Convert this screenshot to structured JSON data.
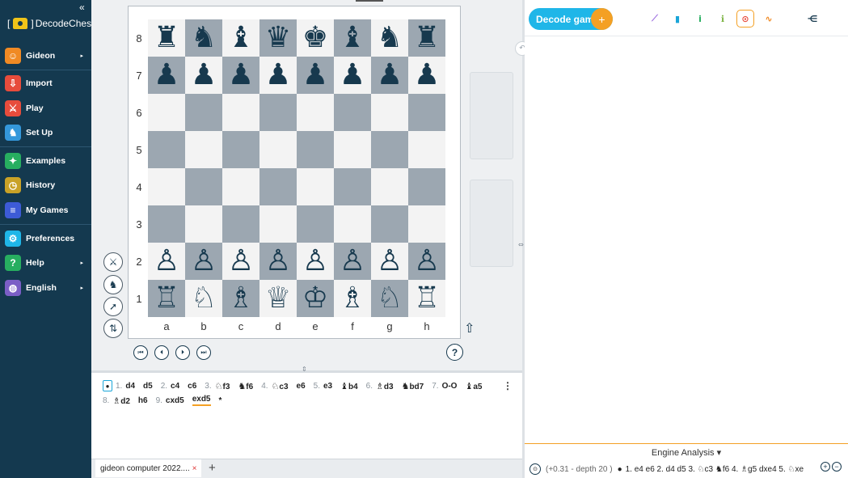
{
  "sidebar": {
    "collapse_icon": "«",
    "brand": "DecodeChess",
    "items": [
      {
        "label": "Gideon",
        "icon": "user-icon",
        "glyph": "☺",
        "color": "#f08a24",
        "arrow": "▸"
      },
      {
        "label": "Import",
        "icon": "import-icon",
        "glyph": "⇩",
        "color": "#e74c3c",
        "arrow": ""
      },
      {
        "label": "Play",
        "icon": "swords-icon",
        "glyph": "⚔",
        "color": "#e74c3c",
        "arrow": ""
      },
      {
        "label": "Set Up",
        "icon": "setup-icon",
        "glyph": "♞",
        "color": "#3498db",
        "arrow": ""
      },
      {
        "label": "Examples",
        "icon": "examples-icon",
        "glyph": "✦",
        "color": "#27ae60",
        "arrow": ""
      },
      {
        "label": "History",
        "icon": "clock-icon",
        "glyph": "◷",
        "color": "#c9a227",
        "arrow": ""
      },
      {
        "label": "My Games",
        "icon": "list-icon",
        "glyph": "≡",
        "color": "#3d5bd6",
        "arrow": ""
      },
      {
        "label": "Preferences",
        "icon": "gear-icon",
        "glyph": "⚙",
        "color": "#1fb6e8",
        "arrow": ""
      },
      {
        "label": "Help",
        "icon": "help-icon",
        "glyph": "?",
        "color": "#27ae60",
        "arrow": "▸"
      },
      {
        "label": "English",
        "icon": "globe-icon",
        "glyph": "◍",
        "color": "#7b5ec6",
        "arrow": "▸"
      }
    ]
  },
  "board": {
    "ranks": [
      "8",
      "7",
      "6",
      "5",
      "4",
      "3",
      "2",
      "1"
    ],
    "files": [
      "a",
      "b",
      "c",
      "d",
      "e",
      "f",
      "g",
      "h"
    ],
    "position": [
      [
        "♜",
        "♞",
        "♝",
        "♛",
        "♚",
        "♝",
        "♞",
        "♜"
      ],
      [
        "♟",
        "♟",
        "♟",
        "♟",
        "♟",
        "♟",
        "♟",
        "♟"
      ],
      [
        "",
        "",
        "",
        "",
        "",
        "",
        "",
        ""
      ],
      [
        "",
        "",
        "",
        "",
        "",
        "",
        "",
        ""
      ],
      [
        "",
        "",
        "",
        "",
        "",
        "",
        "",
        ""
      ],
      [
        "",
        "",
        "",
        "",
        "",
        "",
        "",
        ""
      ],
      [
        "♙",
        "♙",
        "♙",
        "♙",
        "♙",
        "♙",
        "♙",
        "♙"
      ],
      [
        "♖",
        "♘",
        "♗",
        "♕",
        "♔",
        "♗",
        "♘",
        "♖"
      ]
    ]
  },
  "tools": {
    "play_icon": "⚔",
    "setup_icon": "♞",
    "arrow_icon": "➚",
    "flip_icon": "⇅",
    "flip_up_icon": "⇧",
    "undo_icon": "↶",
    "help_label": "?"
  },
  "navigation": {
    "first": "⏮",
    "prev": "⏴",
    "next": "⏵",
    "last": "⏭"
  },
  "moves": {
    "start_marker": "●",
    "menu_icon": "⋮",
    "line1": [
      {
        "num": "1.",
        "white": "d4",
        "black": "d5"
      },
      {
        "num": "2.",
        "white": "c4",
        "black": "c6"
      },
      {
        "num": "3.",
        "white_piece": "♘",
        "white": "f3",
        "black_piece": "♞",
        "black": "f6"
      },
      {
        "num": "4.",
        "white_piece": "♘",
        "white": "c3",
        "black": "e6"
      },
      {
        "num": "5.",
        "white": "e3",
        "black_piece": "♝",
        "black": "b4"
      },
      {
        "num": "6.",
        "white_piece": "♗",
        "white": "d3",
        "black_piece": "♞",
        "black": "bd7"
      },
      {
        "num": "7.",
        "white": "O-O",
        "black_piece": "♝",
        "black": "a5"
      }
    ],
    "line2": [
      {
        "num": "8.",
        "white_piece": "♗",
        "white": "d2",
        "black": "h6"
      },
      {
        "num": "9.",
        "white": "cxd5",
        "black": "exd5"
      }
    ],
    "trailing": "*"
  },
  "game_tab": {
    "label": "gideon computer 2022....",
    "close": "×",
    "add": "+"
  },
  "right_toolbar": {
    "decode_label": "Decode game",
    "decode_plus": "+",
    "icons": [
      {
        "name": "trend-icon",
        "glyph": "⟋",
        "color": "#9b6be0"
      },
      {
        "name": "bar-chart-icon",
        "glyph": "▮",
        "color": "#1aa5d8"
      },
      {
        "name": "info-icon",
        "glyph": "i",
        "color": "#27ae60"
      },
      {
        "name": "stats-icon",
        "glyph": "ℹ",
        "color": "#7cb342"
      },
      {
        "name": "engine-icon",
        "glyph": "⊙",
        "color": "#e74c3c"
      },
      {
        "name": "pulse-icon",
        "glyph": "∿",
        "color": "#f08a24"
      },
      {
        "name": "share-icon",
        "glyph": "⋲",
        "color": "#17394e"
      }
    ]
  },
  "engine": {
    "title": "Engine Analysis ▾",
    "icon": "⊙",
    "eval": "(+0.31 - depth 20 )",
    "line_marker": "●",
    "line": "1. e4  e6 2. d4  d5 3. ♘c3  ♞f6 4. ♗g5  dxe4 5. ♘xe",
    "plus": "+",
    "minus": "−"
  }
}
